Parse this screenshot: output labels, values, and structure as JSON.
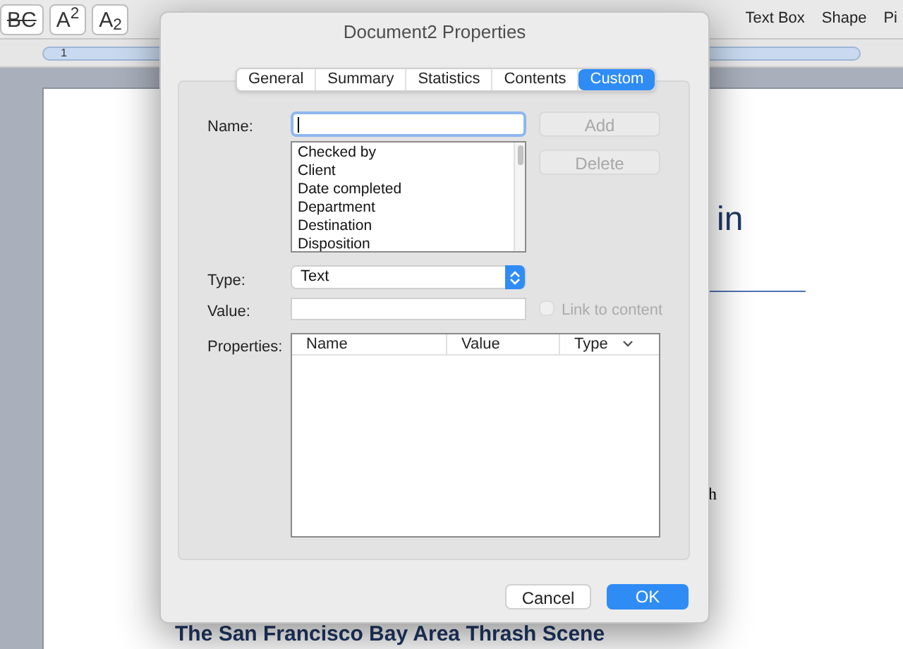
{
  "toolbar": {
    "format_buttons": [
      {
        "label": "BC",
        "kind": "strike"
      },
      {
        "label": "A$^{2}$",
        "kind": "plain"
      },
      {
        "label": "A$_{2}$",
        "kind": "plain"
      }
    ],
    "ribbon_items": [
      {
        "label": "Text Box"
      },
      {
        "label": "Shape"
      },
      {
        "label": "Pi"
      }
    ]
  },
  "ruler": {
    "marker": "1"
  },
  "document": {
    "heading_fragment": "in",
    "text_fragment": "h",
    "subheading": "The San Francisco Bay Area Thrash Scene"
  },
  "dialog": {
    "title": "Document2 Properties",
    "tabs": [
      {
        "label": "General",
        "selected": false
      },
      {
        "label": "Summary",
        "selected": false
      },
      {
        "label": "Statistics",
        "selected": false
      },
      {
        "label": "Contents",
        "selected": false
      },
      {
        "label": "Custom",
        "selected": true
      }
    ],
    "name_label": "Name:",
    "add_button": {
      "label": "Add",
      "disabled": true
    },
    "delete_button": {
      "label": "Delete",
      "disabled": true
    },
    "name_list": [
      "Checked by",
      "Client",
      "Date completed",
      "Department",
      "Destination",
      "Disposition"
    ],
    "type_label": "Type:",
    "type_value": "Text",
    "value_label": "Value:",
    "link_to_content": {
      "label": "Link to content",
      "checked": false,
      "disabled": true
    },
    "properties_label": "Properties:",
    "columns": [
      "Name",
      "Value",
      "Type"
    ],
    "buttons": [
      {
        "label": "Cancel",
        "kind": "normal"
      },
      {
        "label": "OK",
        "kind": "default"
      }
    ]
  }
}
